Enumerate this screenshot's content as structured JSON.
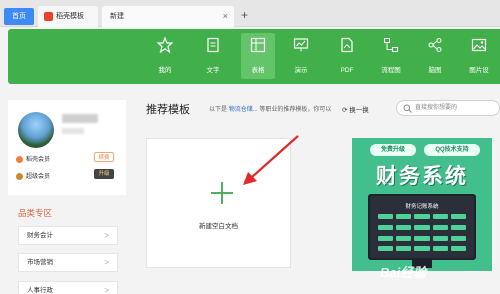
{
  "tabs": [
    {
      "label": "首页"
    },
    {
      "label": "稻壳模板"
    },
    {
      "label": "新建",
      "close": "×"
    }
  ],
  "tab_add": "+",
  "toolbar": {
    "items": [
      {
        "label": "我的",
        "icon": "star-icon"
      },
      {
        "label": "文字",
        "icon": "document-icon"
      },
      {
        "label": "表格",
        "icon": "table-icon",
        "active": true
      },
      {
        "label": "演示",
        "icon": "presentation-icon"
      },
      {
        "label": "PDF",
        "icon": "pdf-icon"
      },
      {
        "label": "流程图",
        "icon": "flowchart-icon"
      },
      {
        "label": "脑图",
        "icon": "mindmap-icon"
      },
      {
        "label": "图片设",
        "icon": "image-icon"
      }
    ],
    "color": "#42b04a"
  },
  "user": {
    "member1_label": "稻壳会员",
    "member1_button": "续费",
    "member2_label": "超级会员",
    "member2_button": "升级"
  },
  "category": {
    "title": "品类专区",
    "items": [
      {
        "label": "财务会计",
        "chev": ">"
      },
      {
        "label": "市场营销",
        "chev": ">"
      },
      {
        "label": "人事行政",
        "chev": ">"
      }
    ]
  },
  "recommend": {
    "title": "推荐模板",
    "sub_prefix": "以下是",
    "sub_link": "物流仓储...",
    "sub_suffix": "等职业的推荐模板，你可以",
    "refresh": "换一换",
    "search_placeholder": "直接搜你想要的"
  },
  "new_blank": {
    "label": "新建空白文档"
  },
  "promo": {
    "badge1": "免费升级",
    "badge2": "QQ技术支持",
    "headline": "财务系统",
    "screen_title": "财务记账系统"
  },
  "watermark": "Bai经验"
}
